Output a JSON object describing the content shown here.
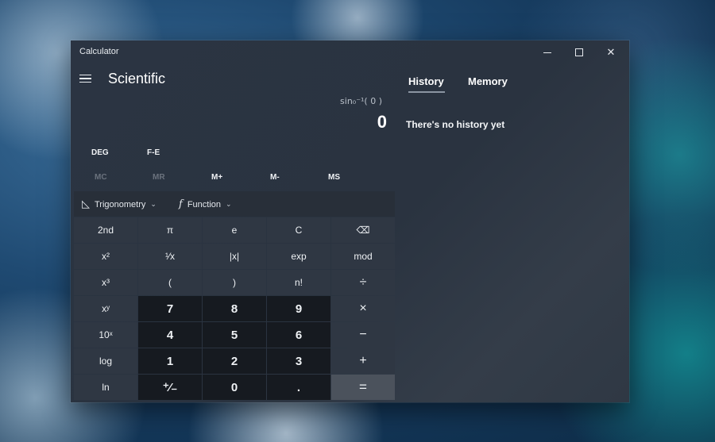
{
  "window": {
    "title": "Calculator"
  },
  "header": {
    "mode": "Scientific"
  },
  "display": {
    "expression": "sin₀⁻¹( 0 )",
    "value": "0"
  },
  "modes": {
    "angle": "DEG",
    "fe": "F-E"
  },
  "memory": {
    "mc": "MC",
    "mr": "MR",
    "m_plus": "M+",
    "m_minus": "M-",
    "ms": "MS"
  },
  "funcbar": {
    "trig": "Trigonometry",
    "func": "Function"
  },
  "keys": [
    "2nd",
    "π",
    "e",
    "C",
    "⌫",
    "x²",
    "¹⁄x",
    "|x|",
    "exp",
    "mod",
    "x³",
    "(",
    ")",
    "n!",
    "÷",
    "xʸ",
    "7",
    "8",
    "9",
    "×",
    "10ˣ",
    "4",
    "5",
    "6",
    "−",
    "log",
    "1",
    "2",
    "3",
    "+",
    "ln",
    "⁺⁄₋",
    "0",
    ".",
    "="
  ],
  "side": {
    "tab_history": "History",
    "tab_memory": "Memory",
    "empty": "There's no history yet"
  },
  "colors": {
    "window_bg": "#2b3442",
    "number_key": "#161a20",
    "function_key": "#2f3743",
    "equals_key": "#4b525c"
  }
}
